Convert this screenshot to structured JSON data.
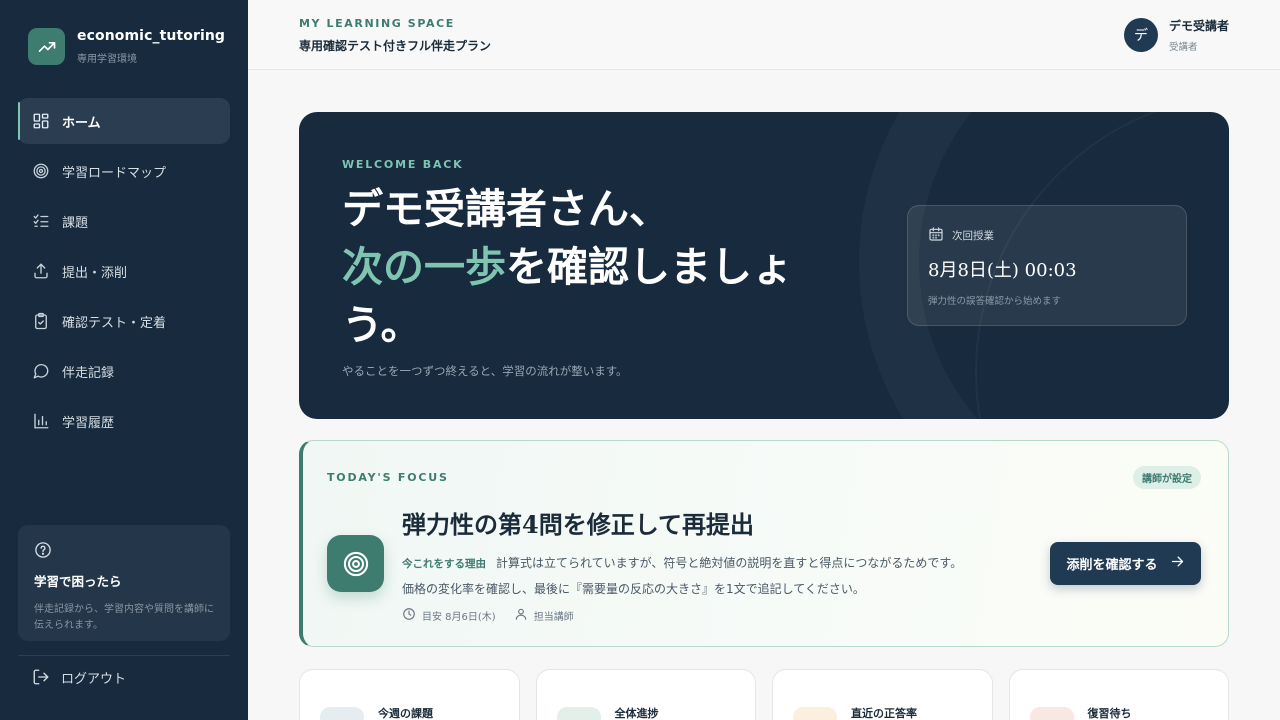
{
  "brand": {
    "name": "economic_tutoring",
    "subtitle": "専用学習環境"
  },
  "nav": [
    {
      "label": "ホーム",
      "icon": "dashboard-icon",
      "active": true
    },
    {
      "label": "学習ロードマップ",
      "icon": "target-icon"
    },
    {
      "label": "課題",
      "icon": "checklist-icon"
    },
    {
      "label": "提出・添削",
      "icon": "upload-icon"
    },
    {
      "label": "確認テスト・定着",
      "icon": "clipboard-check-icon"
    },
    {
      "label": "伴走記録",
      "icon": "chat-bubble-icon"
    },
    {
      "label": "学習履歴",
      "icon": "bar-chart-icon"
    }
  ],
  "help": {
    "title": "学習で困ったら",
    "description": "伴走記録から、学習内容や質問を講師に伝えられます。"
  },
  "logout_label": "ログアウト",
  "header": {
    "kicker": "MY LEARNING SPACE",
    "plan": "専用確認テスト付きフル伴走プラン"
  },
  "user": {
    "avatar_initial": "デ",
    "name": "デモ受講者",
    "role": "受講者"
  },
  "hero": {
    "kicker": "WELCOME BACK",
    "title_line1": "デモ受講者さん、",
    "title_accent": "次の一歩",
    "title_rest": "を確認しましょう。",
    "subtitle": "やることを一つずつ終えると、学習の流れが整います。"
  },
  "next_lesson": {
    "label": "次回授業",
    "datetime": "8月8日(土) 00:03",
    "note": "弾力性の誤答確認から始めます"
  },
  "focus": {
    "kicker": "TODAY'S FOCUS",
    "badge": "講師が設定",
    "title": "弾力性の第4問を修正して再提出",
    "reason_tag": "今これをする理由",
    "reason": "計算式は立てられていますが、符号と絶対値の説明を直すと得点につながるためです。",
    "detail": "価格の変化率を確認し、最後に『需要量の反応の大きさ』を1文で追記してください。",
    "due": "目安 8月6日(木)",
    "owner": "担当講師",
    "button": "添削を確認する"
  },
  "stats": [
    {
      "label": "今週の課題",
      "color": "#e6edf1"
    },
    {
      "label": "全体進捗",
      "color": "#e3efe9"
    },
    {
      "label": "直近の正答率",
      "color": "#fbefdd"
    },
    {
      "label": "復習待ち",
      "color": "#f9e7e3"
    }
  ],
  "colors": {
    "sidebar": "#172a3e",
    "accent": "#3f7c70",
    "accent_light": "#7fc4b1",
    "primary_button": "#1f3a52"
  }
}
